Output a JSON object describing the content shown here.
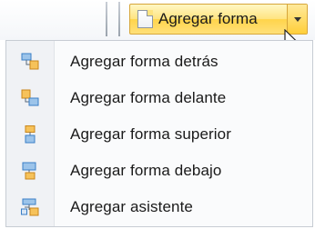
{
  "ribbon": {
    "button_label": "Agregar forma",
    "button_icon": "document-icon",
    "arrow_icon": "dropdown-arrow-icon"
  },
  "menu": {
    "items": [
      {
        "label": "Agregar forma detrás",
        "icon": "add-shape-after-icon"
      },
      {
        "label": "Agregar forma delante",
        "icon": "add-shape-before-icon"
      },
      {
        "label": "Agregar forma superior",
        "icon": "add-shape-above-icon"
      },
      {
        "label": "Agregar forma debajo",
        "icon": "add-shape-below-icon"
      },
      {
        "label": "Agregar asistente",
        "icon": "add-assistant-icon"
      }
    ]
  },
  "colors": {
    "accent": "#ffe480",
    "accent_border": "#d7a63a",
    "icon_orange": "#f2a33a",
    "icon_blue": "#3a7fc6"
  }
}
